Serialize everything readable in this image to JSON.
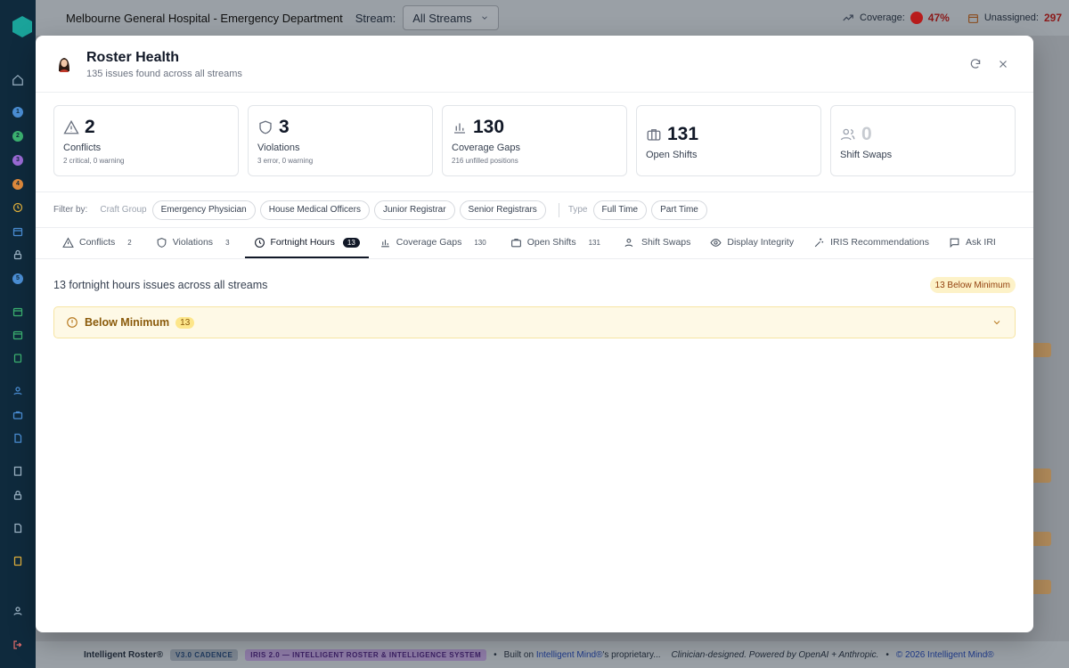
{
  "app": {
    "hospital": "Melbourne General Hospital - Emergency Department",
    "stream_label": "Stream:",
    "stream_value": "All Streams",
    "coverage_label": "Coverage:",
    "coverage_value": "47%",
    "unassigned_label": "Unassigned:",
    "unassigned_value": "297",
    "rail_numbers": [
      "1",
      "2",
      "3",
      "4",
      "5"
    ]
  },
  "modal": {
    "title": "Roster Health",
    "subtitle": "135 issues found across all streams"
  },
  "stats": [
    {
      "icon": "warning-triangle-icon",
      "value": "2",
      "label": "Conflicts",
      "desc": "2 critical, 0 warning"
    },
    {
      "icon": "shield-icon",
      "value": "3",
      "label": "Violations",
      "desc": "3 error, 0 warning"
    },
    {
      "icon": "bar-chart-icon",
      "value": "130",
      "label": "Coverage Gaps",
      "desc": "216 unfilled positions"
    },
    {
      "icon": "briefcase-icon",
      "value": "131",
      "label": "Open Shifts",
      "desc": ""
    },
    {
      "icon": "users-icon",
      "value": "0",
      "label": "Shift Swaps",
      "desc": ""
    }
  ],
  "filters": {
    "label": "Filter by:",
    "craft_group_label": "Craft Group",
    "craft_groups": [
      "Emergency Physician",
      "House Medical Officers",
      "Junior Registrar",
      "Senior Registrars"
    ],
    "type_label": "Type",
    "types": [
      "Full Time",
      "Part Time"
    ]
  },
  "tabs": [
    {
      "label": "Conflicts",
      "count": "2",
      "icon": "warning-triangle-icon"
    },
    {
      "label": "Violations",
      "count": "3",
      "icon": "shield-icon"
    },
    {
      "label": "Fortnight Hours",
      "count": "13",
      "icon": "clock-icon",
      "active": true
    },
    {
      "label": "Coverage Gaps",
      "count": "130",
      "icon": "bar-chart-icon"
    },
    {
      "label": "Open Shifts",
      "count": "131",
      "icon": "briefcase-icon"
    },
    {
      "label": "Shift Swaps",
      "count": "",
      "icon": "users-icon"
    },
    {
      "label": "Display Integrity",
      "count": "",
      "icon": "eye-icon"
    },
    {
      "label": "IRIS Recommendations",
      "count": "",
      "icon": "sparkle-icon"
    },
    {
      "label": "Ask IRI",
      "count": "",
      "icon": "chat-icon"
    }
  ],
  "content": {
    "summary": "13 fortnight hours issues across all streams",
    "badge": "13 Below Minimum",
    "group_title": "Below Minimum",
    "group_count": "13"
  },
  "footer": {
    "brand": "Intelligent Roster®",
    "version": "V3.0 CADENCE",
    "iris": "IRIS 2.0 — INTELLIGENT ROSTER & INTELLIGENCE SYSTEM",
    "built_on": "Built on",
    "built_link": "Intelligent Mind®",
    "built_rest": "'s proprietary...",
    "credit": "Clinician-designed. Powered by OpenAI + Anthropic.",
    "copyright": "© 2026 Intelligent Mind®"
  },
  "colors": {
    "accent": "#111827",
    "warning_bg": "#fef9e6",
    "warning_text": "#8a5a0a",
    "critical": "#b91c1c"
  }
}
